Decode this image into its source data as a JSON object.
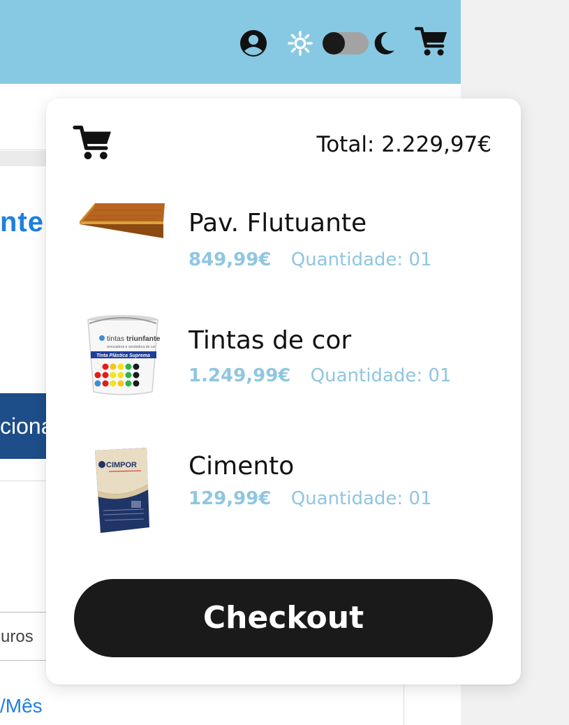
{
  "background": {
    "title_fragment": "nte",
    "button_fragment": "ciona",
    "input_fragment": "uros",
    "link_fragment": "/Mês"
  },
  "header": {
    "icons": [
      "user-icon",
      "sun-icon",
      "theme-toggle",
      "moon-icon",
      "cart-icon"
    ],
    "accent_color": "#87c9e3",
    "theme_toggle_state": "off"
  },
  "cart": {
    "total_label": "Total: 2.229,97€",
    "items": [
      {
        "name": "Pav. Flutuante",
        "price": "849,99€",
        "quantity_label": "Quantidade: 01",
        "thumbnail": "floor-plank"
      },
      {
        "name": "Tintas de cor",
        "price": "1.249,99€",
        "quantity_label": "Quantidade: 01",
        "thumbnail": "paint-bucket"
      },
      {
        "name": "Cimento",
        "price": "129,99€",
        "quantity_label": "Quantidade: 01",
        "thumbnail": "cement-bag"
      }
    ],
    "checkout_label": "Checkout",
    "price_color": "#8fc6e0"
  },
  "paint_label": {
    "brand_light": "tintas ",
    "brand_bold": "triunfante",
    "tagline": "renovadora e vendedora de cor",
    "product": "Tinta Plástica Suprema"
  },
  "cement_label": {
    "brand": "CIMPOR"
  }
}
